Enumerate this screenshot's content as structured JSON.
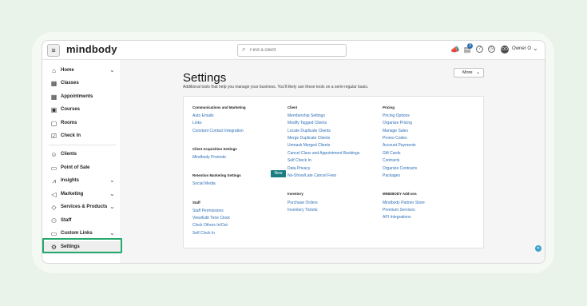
{
  "app": {
    "logo": "mindbody",
    "menu_icon": "≡"
  },
  "topbar": {
    "search_placeholder": "Find a client",
    "tasks_badge": "3",
    "avatar_initials": "OO",
    "owner_label": "Owner O"
  },
  "sidebar": {
    "items": [
      {
        "label": "Home",
        "icon": "home-icon",
        "expandable": true
      },
      {
        "label": "Classes",
        "icon": "calendar-icon",
        "expandable": false
      },
      {
        "label": "Appointments",
        "icon": "calendar-grid-icon",
        "expandable": false
      },
      {
        "label": "Courses",
        "icon": "course-icon",
        "expandable": false
      },
      {
        "label": "Rooms",
        "icon": "rooms-icon",
        "expandable": false
      },
      {
        "label": "Check In",
        "icon": "check-in-icon",
        "expandable": false
      },
      {
        "label": "Clients",
        "icon": "clients-icon",
        "expandable": false
      },
      {
        "label": "Point of Sale",
        "icon": "pos-icon",
        "expandable": false
      },
      {
        "label": "Insights",
        "icon": "insights-icon",
        "expandable": true
      },
      {
        "label": "Marketing",
        "icon": "megaphone-icon",
        "expandable": true
      },
      {
        "label": "Services & Products",
        "icon": "tag-icon",
        "expandable": true
      },
      {
        "label": "Staff",
        "icon": "staff-icon",
        "expandable": false
      },
      {
        "label": "Custom Links",
        "icon": "link-icon",
        "expandable": true
      },
      {
        "label": "Settings",
        "icon": "gear-icon",
        "expandable": false,
        "active": true
      }
    ]
  },
  "main": {
    "title": "Settings",
    "subtitle": "Additional tools that help you manage your business. You'll likely use these tools on a semi-regular basis.",
    "more_label": "More",
    "new_badge": "New",
    "sections": {
      "communications": {
        "title": "Communications and Marketing",
        "links": [
          "Auto Emails",
          "Links",
          "Constant Contact Integration"
        ]
      },
      "client_acquisition": {
        "title": "Client Acquisition Settings",
        "links": [
          "Mindbody Promote"
        ]
      },
      "retention": {
        "title": "Retention Marketing Settings",
        "links": [
          "Social Media"
        ]
      },
      "staff": {
        "title": "Staff",
        "links": [
          "Staff Permissions",
          "View/Edit Time Clock",
          "Clock Others In/Out",
          "Self Clock In"
        ]
      },
      "client": {
        "title": "Client",
        "links": [
          "Membership Settings",
          "Modify Tagged Clients",
          "Locate Duplicate Clients",
          "Merge Duplicate Clients",
          "Unmask Merged Clients",
          "Cancel Class and Appointment Bookings",
          "Self Check In",
          "Data Privacy",
          "No-Show/Late Cancel Fees"
        ]
      },
      "inventory": {
        "title": "Inventory",
        "links": [
          "Purchase Orders",
          "Inventory Tickets"
        ]
      },
      "pricing": {
        "title": "Pricing",
        "links": [
          "Pricing Options",
          "Organize Pricing",
          "Manage Sales",
          "Promo Codes",
          "Account Payments",
          "Gift Cards",
          "Contracts",
          "Organize Contracts",
          "Packages"
        ]
      },
      "addons": {
        "title": "MINDBODY Add-ons",
        "links": [
          "Mindbody Partner Store",
          "Premium Services",
          "API Integrations"
        ]
      }
    }
  },
  "colors": {
    "background": "#e9f3ea",
    "link": "#2d6fb6",
    "highlight": "#25a96d",
    "new_badge": "#1a7d82"
  }
}
